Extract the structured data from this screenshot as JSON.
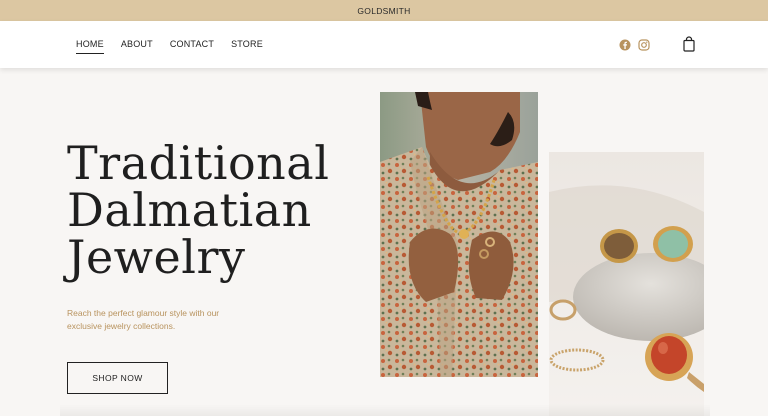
{
  "topbar": {
    "brand": "GOLDSMITH"
  },
  "nav": {
    "items": [
      {
        "label": "HOME",
        "active": true
      },
      {
        "label": "ABOUT",
        "active": false
      },
      {
        "label": "CONTACT",
        "active": false
      },
      {
        "label": "STORE",
        "active": false
      }
    ]
  },
  "social": {
    "icons": [
      "facebook-icon",
      "instagram-icon"
    ],
    "color": "#b8935e"
  },
  "cart": {
    "icon": "shopping-bag-icon"
  },
  "hero": {
    "title_lines": [
      "Traditional",
      "Dalmatian",
      "Jewelry"
    ],
    "subtitle_lines": [
      "Reach the perfect glamour style with our",
      "exclusive jewelry collections."
    ],
    "cta_label": "SHOP NOW"
  },
  "colors": {
    "topbar": "#dcc7a2",
    "accent": "#b8935e",
    "background": "#f8f6f4",
    "text": "#1f1f1f"
  }
}
